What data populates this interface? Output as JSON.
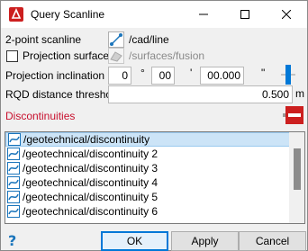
{
  "window": {
    "title": "Query Scanline"
  },
  "scanline": {
    "label": "2-point scanline",
    "value": "/cad/line"
  },
  "projection_surface": {
    "label": "Projection surface",
    "checked": false,
    "value": "/surfaces/fusion"
  },
  "inclination": {
    "label": "Projection inclination",
    "degrees": "0",
    "degrees_unit": "°",
    "minutes": "00",
    "minutes_unit": "'",
    "seconds": "00.000",
    "seconds_unit": "\""
  },
  "rqd": {
    "label": "RQD distance threshold",
    "value": "0.500",
    "unit": "m"
  },
  "discontinuities": {
    "label": "Discontinuities",
    "items": [
      "/geotechnical/discontinuity",
      "/geotechnical/discontinuity 2",
      "/geotechnical/discontinuity 3",
      "/geotechnical/discontinuity 4",
      "/geotechnical/discontinuity 5",
      "/geotechnical/discontinuity 6"
    ]
  },
  "buttons": {
    "ok": "OK",
    "apply": "Apply",
    "cancel": "Cancel"
  },
  "colors": {
    "accent_red": "#cc1f1f",
    "accent_blue": "#0078d7",
    "label_red": "#c8102e"
  }
}
